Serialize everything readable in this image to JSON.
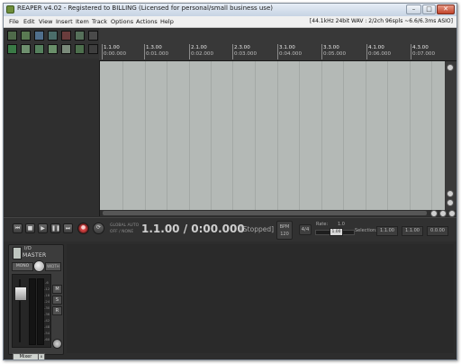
{
  "window": {
    "title": "REAPER v4.02 - Registered to BILLING (Licensed for personal/small business use)",
    "buttons": {
      "minimize": "–",
      "maximize": "□",
      "close": "✕"
    }
  },
  "menu": {
    "items": [
      "File",
      "Edit",
      "View",
      "Insert",
      "Item",
      "Track",
      "Options",
      "Actions",
      "Help"
    ],
    "audio_info": "[44.1kHz 24bit WAV : 2/2ch 96spls ~6.6/6.3ms ASIO]"
  },
  "toolbar": {
    "icons": [
      "new-project-icon",
      "open-project-icon",
      "save-project-icon",
      "project-settings-icon",
      "undo-icon",
      "redo-icon",
      "metronome-icon",
      "snap-icon",
      "ripple-edit-icon",
      "grouping-icon",
      "envelope-icon",
      "grid-icon",
      "loop-icon",
      "lock-icon"
    ]
  },
  "ruler": {
    "markers": [
      {
        "bar": "1.1.00",
        "time": "0:00.000"
      },
      {
        "bar": "1.3.00",
        "time": "0:01.000"
      },
      {
        "bar": "2.1.00",
        "time": "0:02.000"
      },
      {
        "bar": "2.3.00",
        "time": "0:03.000"
      },
      {
        "bar": "3.1.00",
        "time": "0:04.000"
      },
      {
        "bar": "3.3.00",
        "time": "0:05.000"
      },
      {
        "bar": "4.1.00",
        "time": "0:06.000"
      },
      {
        "bar": "4.3.00",
        "time": "0:07.000"
      }
    ]
  },
  "transport": {
    "buttons": {
      "go_start": "⏮",
      "stop": "■",
      "play": "▶",
      "pause": "❚❚",
      "go_end": "⏭",
      "record": "●",
      "repeat": "⟳"
    },
    "global_auto": "GLOBAL AUTO",
    "auto_mode": "OFF / NONE",
    "position": "1.1.00 / 0:00.000",
    "status": "[Stopped]",
    "bpm_label": "BPM",
    "bpm_value": "120",
    "time_sig": "4/4",
    "rate_label": "Rate:",
    "rate_value": "1.0",
    "rate_knob": "1.00",
    "selection_label": "Selection:",
    "selection_start": "1.1.00",
    "selection_end": "1.1.00",
    "selection_length": "0.0.00"
  },
  "mixer": {
    "io": "I/O",
    "master_label": "MASTER",
    "mono_label": "MONO",
    "width_label": "WIDTH",
    "mute": "M",
    "solo": "S",
    "route": "R",
    "scale": [
      "-6",
      "-12",
      "-18",
      "-24",
      "-30",
      "-36",
      "-42",
      "-48",
      "-54",
      "-60"
    ],
    "tab_label": "Mixer",
    "tab_close": "x"
  },
  "colors": {
    "arrange_bg": "#b4b9b6",
    "panel_bg": "#2b2b2b",
    "record_red": "#d04040"
  }
}
